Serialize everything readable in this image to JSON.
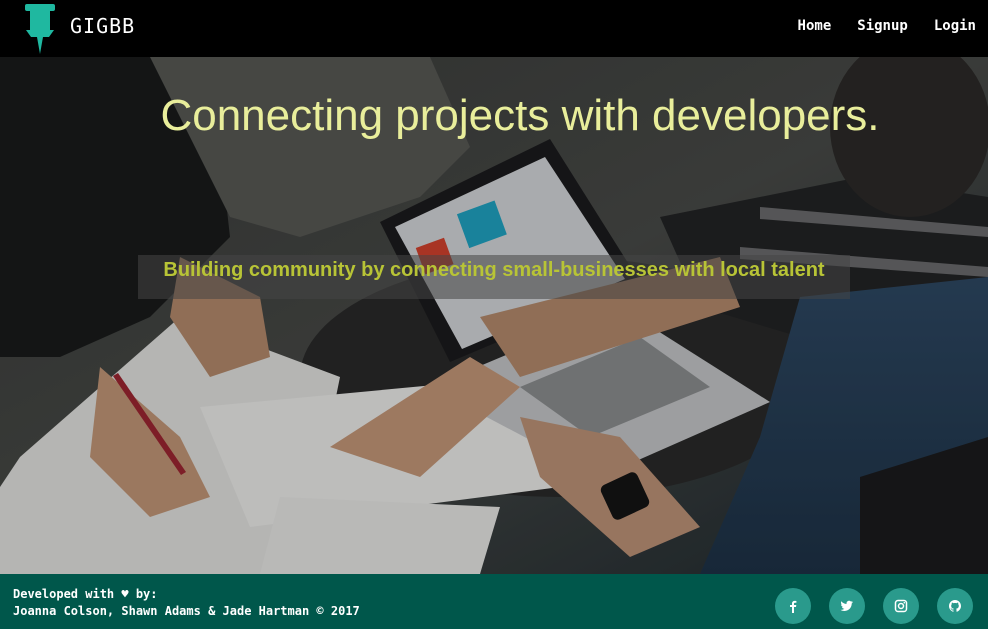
{
  "navbar": {
    "brand": "GIGBB",
    "links": [
      {
        "label": "Home"
      },
      {
        "label": "Signup"
      },
      {
        "label": "Login"
      }
    ],
    "brand_color": "#1fb8a0"
  },
  "hero": {
    "title": "Connecting projects with developers.",
    "tagline": "Building community by connecting small-businesses with local talent",
    "title_color": "#e9ee9b",
    "tagline_color": "#b8c436"
  },
  "footer": {
    "line1": "Developed with ♥ by:",
    "line2": "Joanna Colson, Shawn Adams & Jade Hartman © 2017",
    "social": [
      "facebook-icon",
      "twitter-icon",
      "instagram-icon",
      "github-icon"
    ],
    "background": "#00574b"
  }
}
